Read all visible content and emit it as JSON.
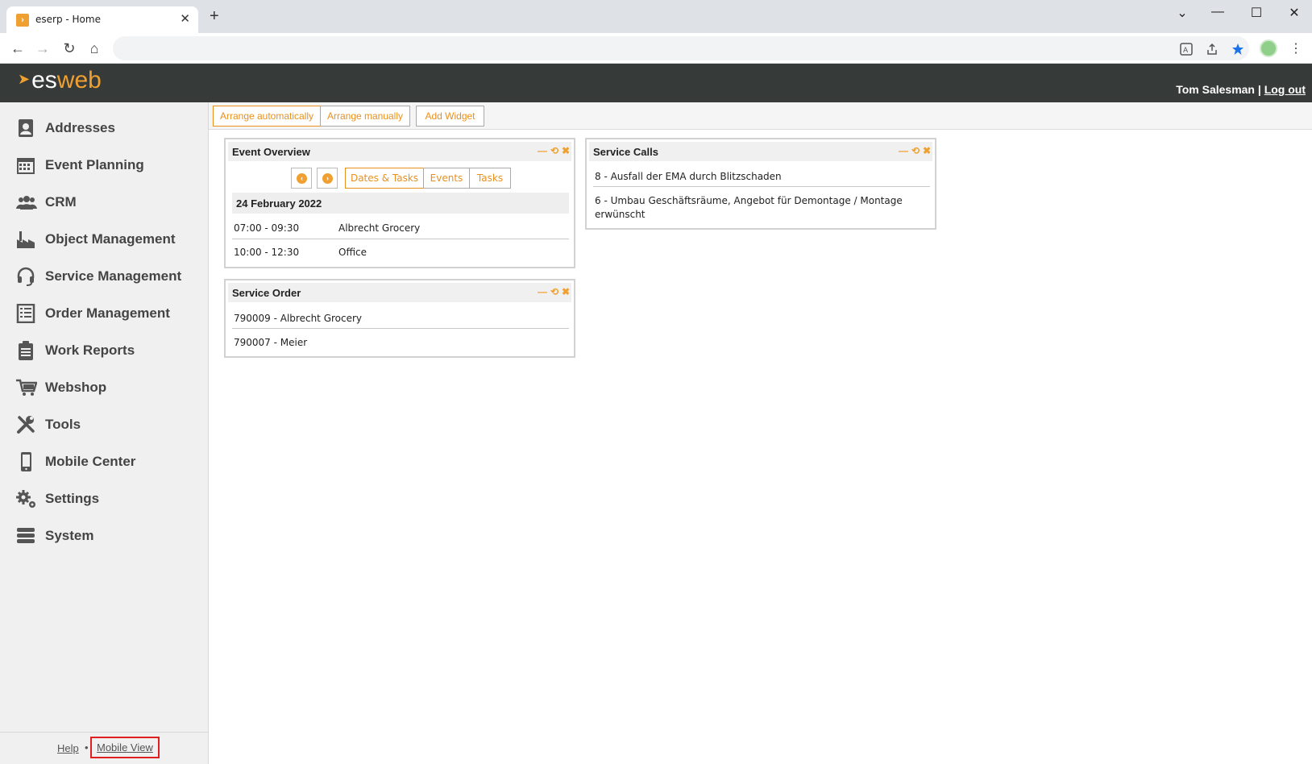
{
  "browser": {
    "tab_title": "eserp - Home",
    "favicon_glyph": "›",
    "tab_close": "✕",
    "new_tab": "+",
    "controls": [
      "⌄",
      "—",
      "☐",
      "✕"
    ],
    "nav": {
      "back": "←",
      "forward": "→",
      "reload": "↻",
      "home": "⌂"
    },
    "omnibox_icons": [
      "translate-icon",
      "share-icon",
      "star-icon"
    ],
    "kebab": "⋮"
  },
  "header": {
    "logo_es": "es",
    "logo_web": "web",
    "user_name": "Tom Salesman",
    "separator": " | ",
    "logout": "Log out"
  },
  "sidebar": {
    "items": [
      {
        "label": "Addresses",
        "icon": "address-book-icon"
      },
      {
        "label": "Event Planning",
        "icon": "calendar-icon"
      },
      {
        "label": "CRM",
        "icon": "users-icon"
      },
      {
        "label": "Object Management",
        "icon": "factory-icon"
      },
      {
        "label": "Service Management",
        "icon": "headset-icon"
      },
      {
        "label": "Order Management",
        "icon": "list-icon"
      },
      {
        "label": "Work Reports",
        "icon": "clipboard-icon"
      },
      {
        "label": "Webshop",
        "icon": "cart-icon"
      },
      {
        "label": "Tools",
        "icon": "tools-icon"
      },
      {
        "label": "Mobile Center",
        "icon": "mobile-icon"
      },
      {
        "label": "Settings",
        "icon": "gears-icon"
      },
      {
        "label": "System",
        "icon": "server-icon"
      }
    ],
    "footer": {
      "help": "Help",
      "dot": "•",
      "mobile_view": "Mobile View"
    }
  },
  "toolbar": {
    "arrange_auto": "Arrange automatically",
    "arrange_manual": "Arrange manually",
    "add_widget": "Add Widget"
  },
  "widgets": {
    "controls": {
      "minimize": "—",
      "refresh": "⟲",
      "close": "✖"
    },
    "event_overview": {
      "title": "Event Overview",
      "prev": "‹",
      "next": "›",
      "tabs": [
        "Dates & Tasks",
        "Events",
        "Tasks"
      ],
      "date": "24 February 2022",
      "rows": [
        {
          "time": "07:00 - 09:30",
          "name": "Albrecht Grocery"
        },
        {
          "time": "10:00 - 12:30",
          "name": "Office"
        }
      ]
    },
    "service_order": {
      "title": "Service Order",
      "rows": [
        "790009 - Albrecht Grocery",
        "790007 - Meier"
      ]
    },
    "service_calls": {
      "title": "Service Calls",
      "rows": [
        "8 - Ausfall der EMA durch Blitzschaden",
        "6 - Umbau Geschäftsräume, Angebot für Demontage / Montage erwünscht"
      ]
    }
  },
  "colors": {
    "accent": "#f0a030",
    "header_bg": "#363a38",
    "sidebar_bg": "#f0f0f0",
    "highlight_border": "#e02020"
  }
}
